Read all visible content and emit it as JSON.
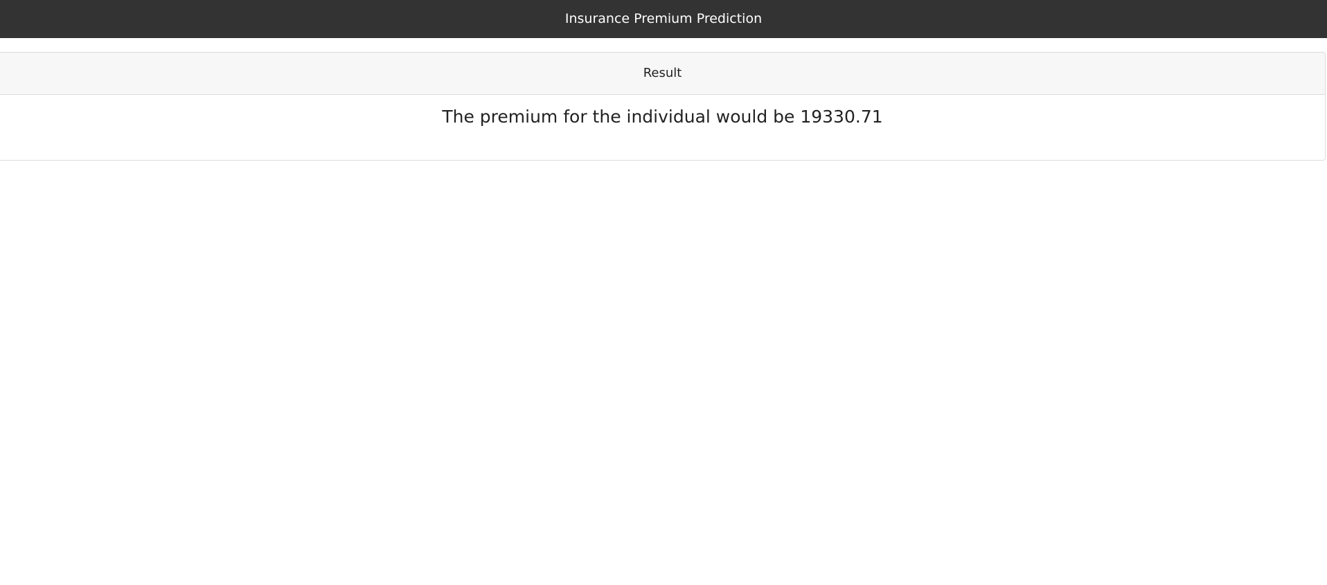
{
  "header": {
    "title": "Insurance Premium Prediction"
  },
  "result_card": {
    "title": "Result",
    "message": "The premium for the individual would be 19330.71"
  },
  "colors": {
    "navbar_background": "#333333",
    "navbar_text": "#ffffff",
    "card_header_background": "#f7f7f7",
    "card_border": "#dcdcdc",
    "text": "#222222"
  }
}
